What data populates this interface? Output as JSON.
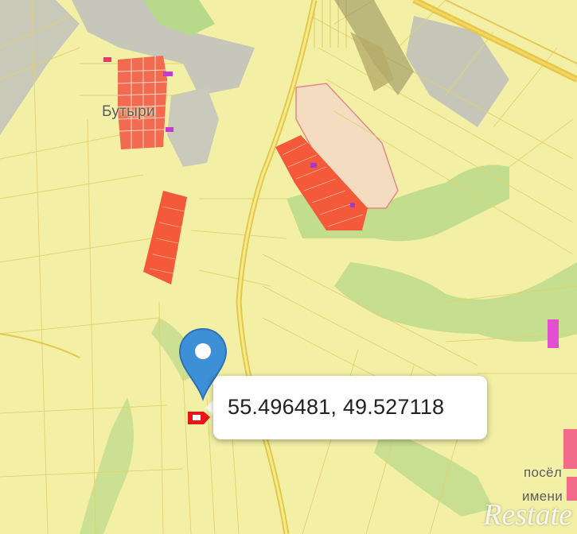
{
  "map": {
    "place_labels": {
      "village_top": "Бутыри",
      "settlement_line1": "посёл",
      "settlement_line2": "имени"
    },
    "marker": {
      "coordinates": "55.496481, 49.527118",
      "pin_icon": "map-pin-icon",
      "pin_color": "#3d8fd6"
    },
    "colors": {
      "land": "#f3f0a6",
      "plot_lines": "#e6d46c",
      "road": "#e2c84b",
      "forest": "#b9d98a",
      "built_up": "#f45a3a",
      "developed": "#f4dcc0"
    },
    "watermark": "Restate"
  }
}
